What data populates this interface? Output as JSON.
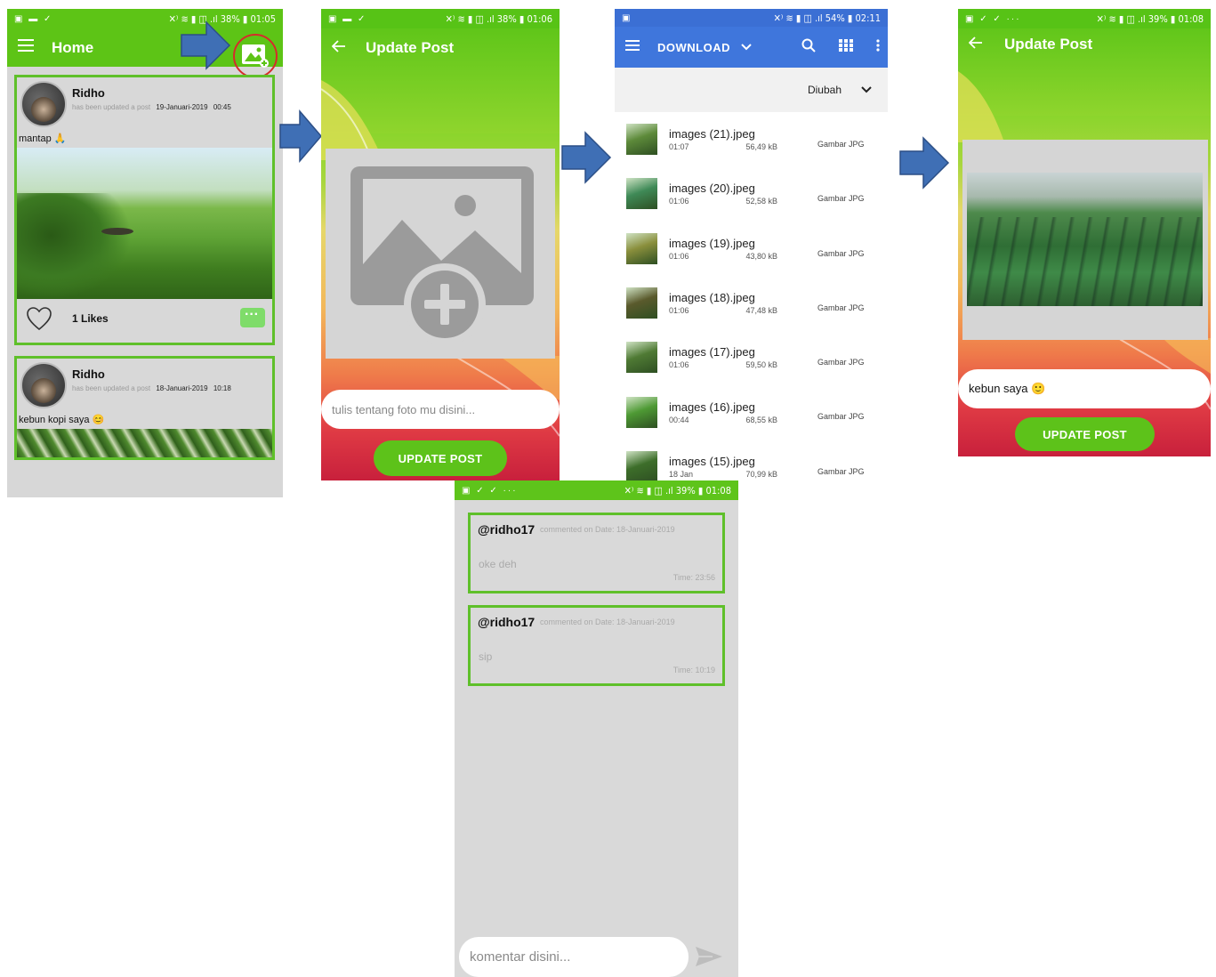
{
  "screen_home": {
    "status_left": "▣ ▬ ✓",
    "status_right": "✕⁾ ≋ ▮ ◫ .ıl 38% ▮ 01:05",
    "title": "Home",
    "posts": [
      {
        "name": "Ridho",
        "action": "has been updated a post",
        "date": "19-Januari-2019",
        "time": "00:45",
        "caption": "mantap 🙏",
        "likes": "1 Likes"
      },
      {
        "name": "Ridho",
        "action": "has been updated a post",
        "date": "18-Januari-2019",
        "time": "10:18",
        "caption": "kebun kopi saya 😊"
      }
    ]
  },
  "screen_update_empty": {
    "status_left": "▣ ▬ ✓",
    "status_right": "✕⁾ ≋ ▮ ◫ .ıl 38% ▮ 01:06",
    "title": "Update Post",
    "caption_placeholder": "tulis tentang foto mu disini...",
    "button_label": "UPDATE POST"
  },
  "screen_picker": {
    "status_left": "▣",
    "status_right": "✕⁾ ≋ ▮ ◫ .ıl 54% ▮ 02:11",
    "title": "DOWNLOAD",
    "sort_label": "Diubah",
    "files": [
      {
        "name": "images (21).jpeg",
        "time": "01:07",
        "size": "56,49 kB",
        "type": "Gambar JPG",
        "color": "#5d8a3a"
      },
      {
        "name": "images (20).jpeg",
        "time": "01:06",
        "size": "52,58 kB",
        "type": "Gambar JPG",
        "color": "#3f8a57"
      },
      {
        "name": "images (19).jpeg",
        "time": "01:06",
        "size": "43,80 kB",
        "type": "Gambar JPG",
        "color": "#8a8f3c"
      },
      {
        "name": "images (18).jpeg",
        "time": "01:06",
        "size": "47,48 kB",
        "type": "Gambar JPG",
        "color": "#5a5a2c"
      },
      {
        "name": "images (17).jpeg",
        "time": "01:06",
        "size": "59,50 kB",
        "type": "Gambar JPG",
        "color": "#4f7a34"
      },
      {
        "name": "images (16).jpeg",
        "time": "00:44",
        "size": "68,55 kB",
        "type": "Gambar JPG",
        "color": "#4e9a34"
      },
      {
        "name": "images (15).jpeg",
        "time": "18 Jan",
        "size": "70,99 kB",
        "type": "Gambar JPG",
        "color": "#3d6e2a"
      }
    ]
  },
  "screen_update_filled": {
    "status_left": "▣ ✓ ✓ ···",
    "status_right": "✕⁾ ≋ ▮ ◫ .ıl 39% ▮ 01:08",
    "title": "Update Post",
    "caption_value": "kebun saya 🙂",
    "button_label": "UPDATE POST"
  },
  "screen_comments": {
    "status_left": "▣ ✓ ✓ ···",
    "status_right": "✕⁾ ≋ ▮ ◫ .ıl 39% ▮ 01:08",
    "comments": [
      {
        "user": "@ridho17",
        "meta": "commented on  Date: 18-Januari-2019",
        "text": "oke deh",
        "time": "Time: 23:56"
      },
      {
        "user": "@ridho17",
        "meta": "commented on  Date: 18-Januari-2019",
        "text": "sip",
        "time": "Time: 10:19"
      }
    ],
    "input_placeholder": "komentar disini..."
  },
  "colors": {
    "app_green": "#5dc416",
    "card_border": "#5fc02a",
    "picker_blue": "#3f76dc",
    "arrow_blue": "#3f6fb5",
    "highlight_red": "#d62b2b"
  }
}
